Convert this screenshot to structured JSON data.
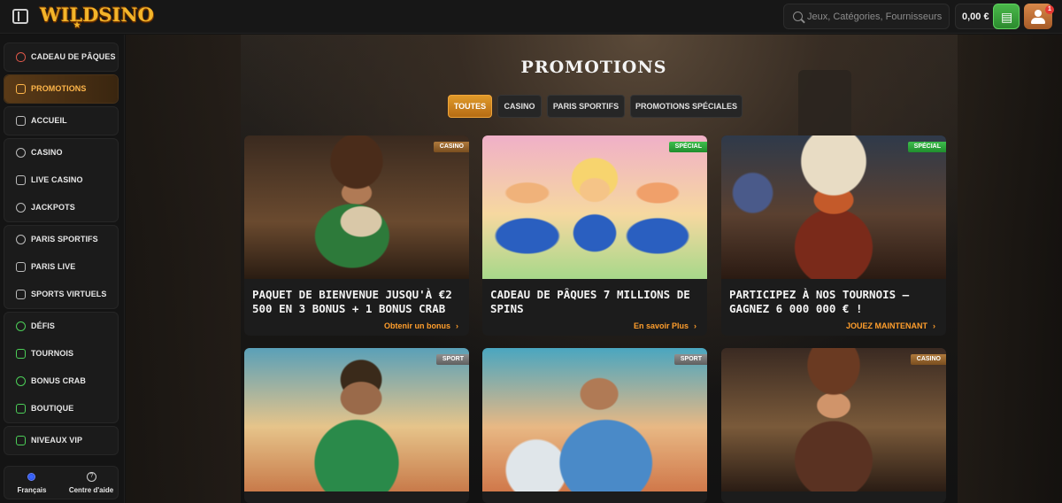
{
  "header": {
    "brand": "WILDSINO",
    "search_placeholder": "Jeux, Catégories, Fournisseurs",
    "balance": "0,00 €",
    "notification_count": "1"
  },
  "sidebar": {
    "groups": [
      [
        {
          "label": "CADEAU DE PÂQUES",
          "icon": "easter-egg-icon"
        }
      ],
      [
        {
          "label": "PROMOTIONS",
          "icon": "gift-icon",
          "active": true
        }
      ],
      [
        {
          "label": "ACCUEIL",
          "icon": "home-icon"
        }
      ],
      [
        {
          "label": "CASINO",
          "icon": "chip-icon"
        },
        {
          "label": "LIVE CASINO",
          "icon": "spade-icon"
        },
        {
          "label": "JACKPOTS",
          "icon": "jackpot-icon"
        }
      ],
      [
        {
          "label": "PARIS SPORTIFS",
          "icon": "ball-icon"
        },
        {
          "label": "PARIS LIVE",
          "icon": "live-icon"
        },
        {
          "label": "SPORTS VIRTUELS",
          "icon": "virtual-sports-icon"
        }
      ],
      [
        {
          "label": "DÉFIS",
          "icon": "challenge-icon"
        },
        {
          "label": "TOURNOIS",
          "icon": "trophy-icon"
        },
        {
          "label": "BONUS CRAB",
          "icon": "crab-icon"
        },
        {
          "label": "BOUTIQUE",
          "icon": "shop-icon"
        }
      ],
      [
        {
          "label": "NIVEAUX VIP",
          "icon": "vip-icon"
        }
      ]
    ],
    "language": "Français",
    "help": "Centre d'aide"
  },
  "main": {
    "title": "PROMOTIONS",
    "tabs": [
      {
        "label": "TOUTES",
        "active": true
      },
      {
        "label": "CASINO"
      },
      {
        "label": "PARIS SPORTIFS"
      },
      {
        "label": "PROMOTIONS SPÉCIALES"
      }
    ],
    "cards": [
      {
        "tag": "CASINO",
        "title": "PAQUET DE BIENVENUE JUSQU'À €2 500 EN 3 BONUS + 1 BONUS CRAB",
        "cta": "Obtenir un bonus"
      },
      {
        "tag": "SPÉCIAL",
        "title": "CADEAU DE PÂQUES 7 MILLIONS DE SPINS",
        "cta": "En savoir Plus"
      },
      {
        "tag": "SPÉCIAL",
        "title": "PARTICIPEZ À NOS TOURNOIS – GAGNEZ 6 000 000 € !",
        "cta": "JOUEZ MAINTENANT"
      },
      {
        "tag": "SPORT",
        "title": "",
        "cta": ""
      },
      {
        "tag": "SPORT",
        "title": "",
        "cta": ""
      },
      {
        "tag": "CASINO",
        "title": "",
        "cta": ""
      }
    ]
  }
}
